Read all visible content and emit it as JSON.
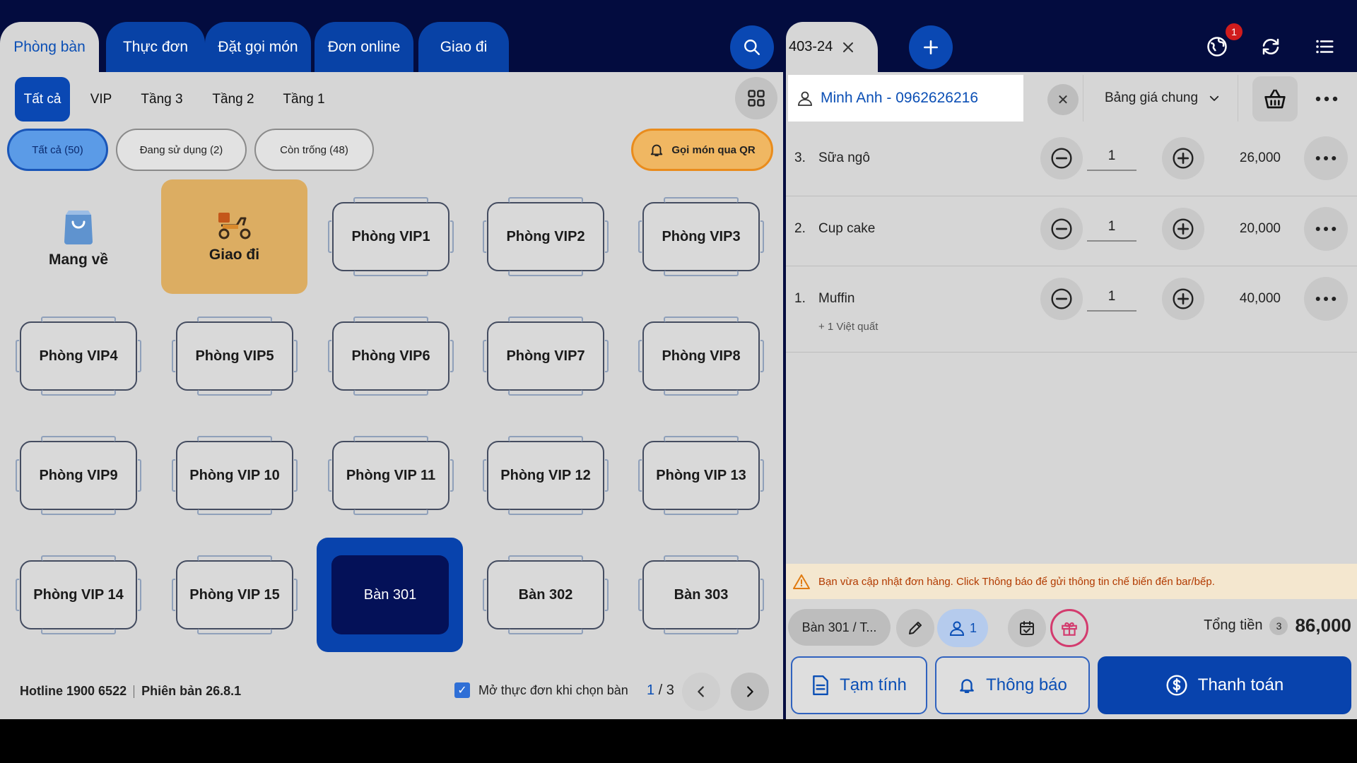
{
  "nav_tabs": [
    "Phòng bàn",
    "Thực đơn",
    "Đặt gọi món",
    "Đơn online",
    "Giao đi"
  ],
  "areas": [
    "Tất cả",
    "VIP",
    "Tầng 3",
    "Tầng 2",
    "Tầng 1"
  ],
  "filters": {
    "all": "Tất cả (50)",
    "in_use": "Đang sử dụng (2)",
    "empty": "Còn trống (48)",
    "qr_order": "Gọi món qua QR"
  },
  "special_tiles": {
    "takeaway": "Mang về",
    "delivery": "Giao đi"
  },
  "tables": [
    "Phòng VIP1",
    "Phòng VIP2",
    "Phòng VIP3",
    "Phòng VIP4",
    "Phòng VIP5",
    "Phòng VIP6",
    "Phòng VIP7",
    "Phòng VIP8",
    "Phòng VIP9",
    "Phòng VIP 10",
    "Phòng VIP 11",
    "Phòng VIP 12",
    "Phòng VIP 13",
    "Phòng VIP 14",
    "Phòng VIP 15",
    "Bàn 301",
    "Bàn 302",
    "Bàn 303"
  ],
  "selected_table": "Bàn 301",
  "footer": {
    "hotline": "Hotline 1900 6522",
    "version": "Phiên bản 26.8.1",
    "open_menu_label": "Mở thực đơn khi chọn bàn",
    "page_current": "1",
    "page_sep": " / ",
    "page_total": "3"
  },
  "order": {
    "tab_label": "403-24",
    "notification_count": "1",
    "customer": "Minh Anh - 0962626216",
    "price_book": "Bảng giá chung",
    "items": [
      {
        "index": "3.",
        "name": "Sữa ngô",
        "qty": "1",
        "price": "26,000",
        "modifier": ""
      },
      {
        "index": "2.",
        "name": "Cup cake",
        "qty": "1",
        "price": "20,000",
        "modifier": ""
      },
      {
        "index": "1.",
        "name": "Muffin",
        "qty": "1",
        "price": "40,000",
        "modifier": "+ 1 Việt quất"
      }
    ],
    "warning": "Bạn vừa cập nhật đơn hàng. Click Thông báo để gửi thông tin chế biến đến bar/bếp.",
    "table_chip": "Bàn 301 / T...",
    "guests": "1",
    "total_label": "Tổng tiền",
    "total_count": "3",
    "total_amount": "86,000",
    "btn_provisional": "Tạm tính",
    "btn_notify": "Thông báo",
    "btn_pay": "Thanh toán"
  },
  "colors": {
    "header_bg": "#030c3f",
    "primary": "#0843ad",
    "panel_bg": "#d6d6d6",
    "delivery_tile": "#dcad62",
    "qr_button": "#f0b762",
    "warning_text": "#b23a00"
  }
}
